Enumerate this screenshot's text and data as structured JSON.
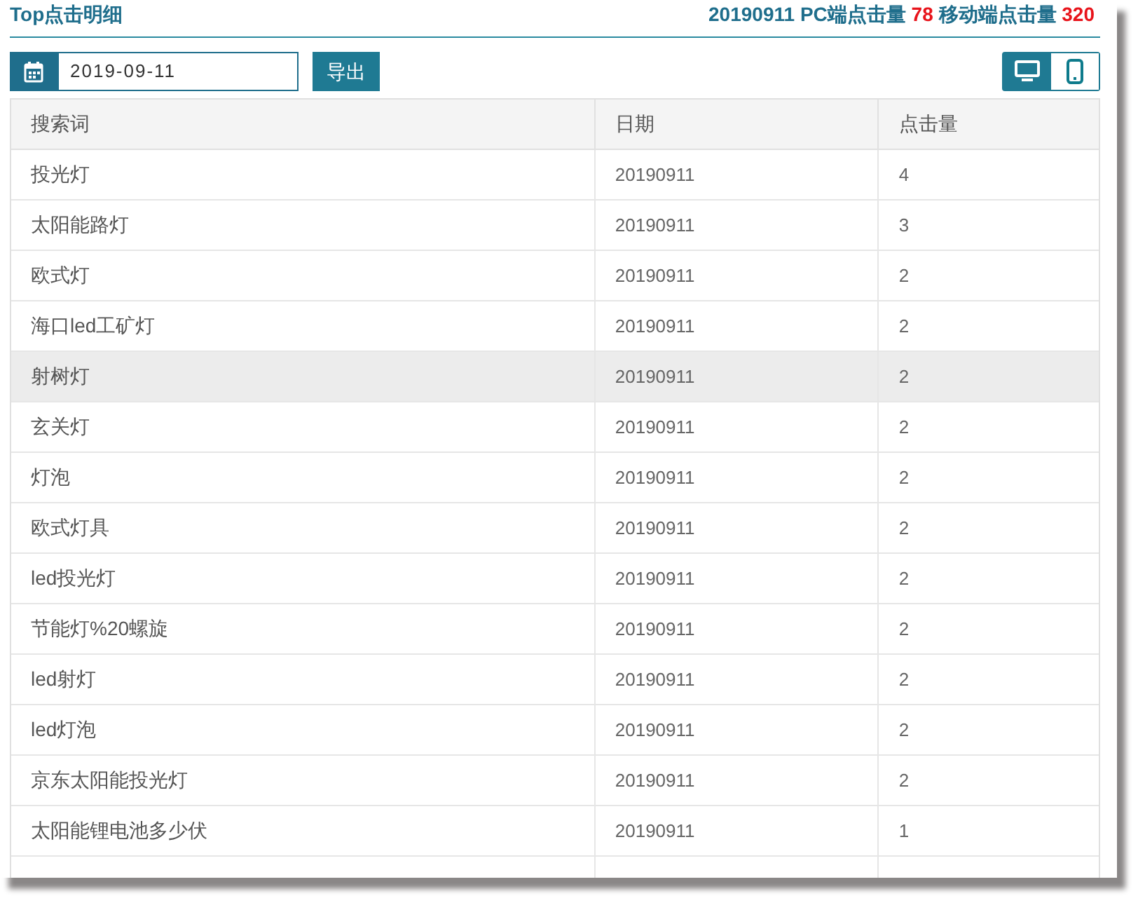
{
  "header": {
    "title": "Top点击明细",
    "summary": {
      "date": "20190911",
      "pc_label": "PC端点击量",
      "pc_value": "78",
      "mobile_label": "移动端点击量",
      "mobile_value": "320"
    }
  },
  "toolbar": {
    "date_value": "2019-09-11",
    "export_button": "导出",
    "view_toggle": [
      {
        "kind": "desktop",
        "selected": true
      },
      {
        "kind": "mobile",
        "selected": false
      }
    ]
  },
  "table": {
    "columns": [
      "搜索词",
      "日期",
      "点击量"
    ],
    "rows": [
      {
        "cells": [
          "投光灯",
          "20190911",
          "4"
        ],
        "selected": false
      },
      {
        "cells": [
          "太阳能路灯",
          "20190911",
          "3"
        ],
        "selected": false
      },
      {
        "cells": [
          "欧式灯",
          "20190911",
          "2"
        ],
        "selected": false
      },
      {
        "cells": [
          "海口led工矿灯",
          "20190911",
          "2"
        ],
        "selected": false
      },
      {
        "cells": [
          "射树灯",
          "20190911",
          "2"
        ],
        "selected": true
      },
      {
        "cells": [
          "玄关灯",
          "20190911",
          "2"
        ],
        "selected": false
      },
      {
        "cells": [
          "灯泡",
          "20190911",
          "2"
        ],
        "selected": false
      },
      {
        "cells": [
          "欧式灯具",
          "20190911",
          "2"
        ],
        "selected": false
      },
      {
        "cells": [
          "led投光灯",
          "20190911",
          "2"
        ],
        "selected": false
      },
      {
        "cells": [
          "节能灯%20螺旋",
          "20190911",
          "2"
        ],
        "selected": false
      },
      {
        "cells": [
          "led射灯",
          "20190911",
          "2"
        ],
        "selected": false
      },
      {
        "cells": [
          "led灯泡",
          "20190911",
          "2"
        ],
        "selected": false
      },
      {
        "cells": [
          "京东太阳能投光灯",
          "20190911",
          "2"
        ],
        "selected": false
      },
      {
        "cells": [
          "太阳能锂电池多少伏",
          "20190911",
          "1"
        ],
        "selected": false
      }
    ]
  }
}
